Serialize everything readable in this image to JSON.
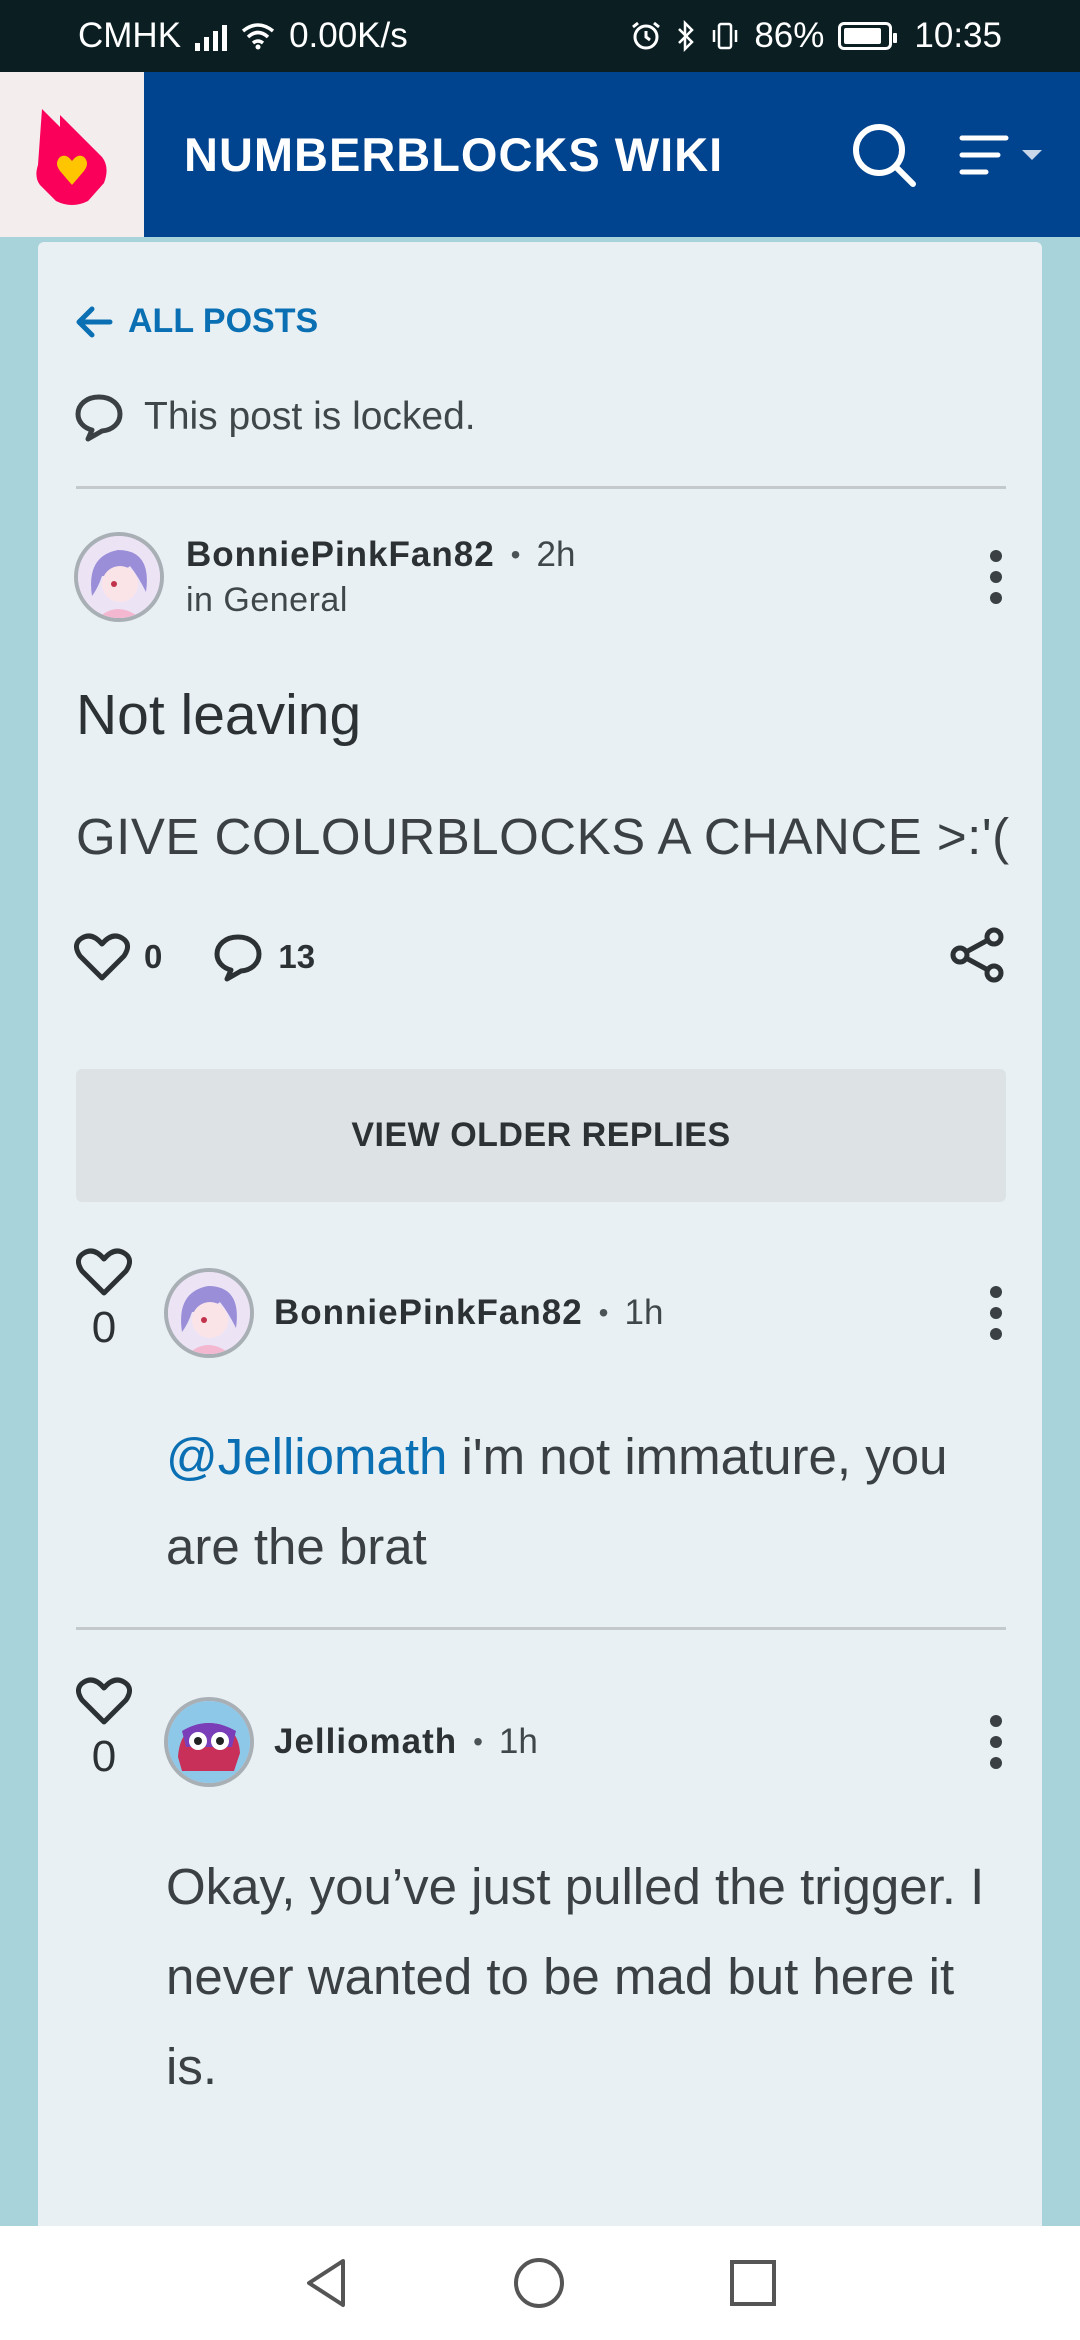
{
  "status_bar": {
    "carrier": "CMHK",
    "speed": "0.00K/s",
    "battery": "86%",
    "time": "10:35",
    "battery_level": 0.86
  },
  "header": {
    "wiki_title": "NUMBERBLOCKS WIKI",
    "logo_icon": "fandom-heart-logo",
    "brand_color": "#00438e"
  },
  "post": {
    "back_label": "ALL POSTS",
    "locked_text": "This post is locked.",
    "author": "BonniePinkFan82",
    "time": "2h",
    "category": "in General",
    "title": "Not leaving",
    "body": "GIVE COLOURBLOCKS A CHANCE >:'(",
    "likes": "0",
    "comments": "13"
  },
  "view_older_label": "VIEW OLDER REPLIES",
  "replies": [
    {
      "likes": "0",
      "author": "BonniePinkFan82",
      "time": "1h",
      "mention": "@Jelliomath",
      "body": " i'm not immature, you are the brat"
    },
    {
      "likes": "0",
      "author": "Jelliomath",
      "time": "1h",
      "body": "Okay, you’ve just pulled the trigger. I never wanted to be mad but here it is."
    }
  ],
  "colors": {
    "link": "#0b6fb3",
    "card_bg": "#e8f0f3",
    "page_bg": "#a9d3da"
  }
}
